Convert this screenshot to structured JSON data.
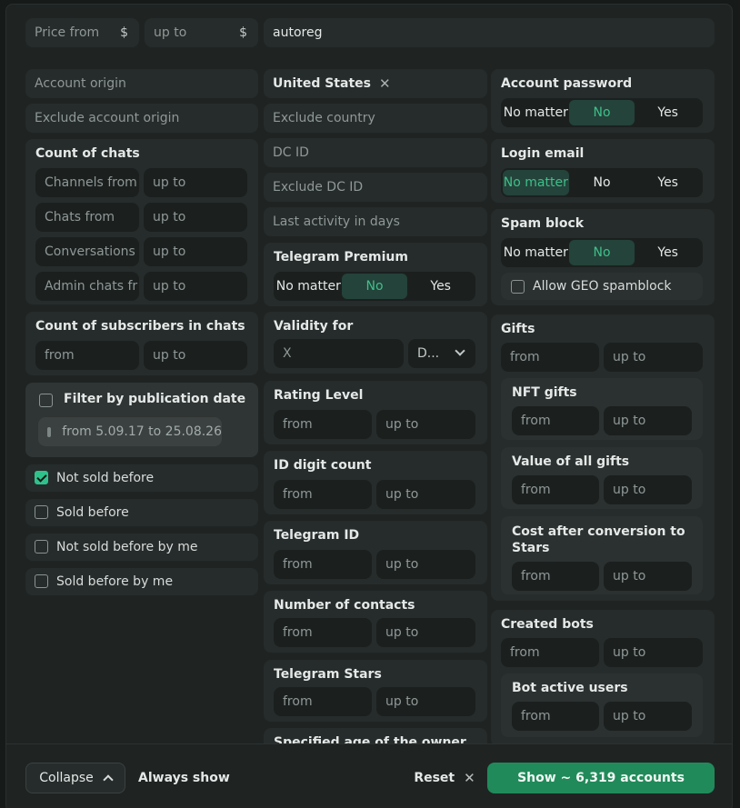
{
  "top": {
    "price_from": "Price from",
    "price_to": "up to",
    "currency": "$",
    "origin_value": "autoreg"
  },
  "col1": {
    "account_origin": "Account origin",
    "exclude_account_origin": "Exclude account origin",
    "count_of_chats": {
      "title": "Count of chats",
      "rows": [
        {
          "from": "Channels from",
          "to": "up to"
        },
        {
          "from": "Chats from",
          "to": "up to"
        },
        {
          "from": "Conversations",
          "to": "up to"
        },
        {
          "from": "Admin chats fr",
          "to": "up to"
        }
      ]
    },
    "subscribers": {
      "title": "Count of subscribers in chats",
      "from": "from",
      "to": "up to"
    },
    "publication": {
      "title": "Filter by publication date",
      "date_range": "from 5.09.17 to 25.08.26",
      "checked": false
    },
    "checks": [
      {
        "label": "Not sold before",
        "checked": true
      },
      {
        "label": "Sold before",
        "checked": false
      },
      {
        "label": "Not sold before by me",
        "checked": false
      },
      {
        "label": "Sold before by me",
        "checked": false
      }
    ]
  },
  "col2": {
    "country_tag": "United States",
    "exclude_country": "Exclude country",
    "dc_id": "DC ID",
    "exclude_dc_id": "Exclude DC ID",
    "last_activity": "Last activity in days",
    "premium": {
      "title": "Telegram Premium",
      "options": [
        "No matter",
        "No",
        "Yes"
      ],
      "active": 1
    },
    "validity": {
      "title": "Validity for",
      "value": "X",
      "unit": "D..."
    },
    "rating": {
      "title": "Rating Level",
      "from": "from",
      "to": "up to"
    },
    "id_digit": {
      "title": "ID digit count",
      "from": "from",
      "to": "up to"
    },
    "telegram_id": {
      "title": "Telegram ID",
      "from": "from",
      "to": "up to"
    },
    "contacts": {
      "title": "Number of contacts",
      "from": "from",
      "to": "up to"
    },
    "stars": {
      "title": "Telegram Stars",
      "from": "from",
      "to": "up to"
    },
    "owner_age": {
      "title": "Specified age of the owner"
    }
  },
  "col3": {
    "password": {
      "title": "Account password",
      "options": [
        "No matter",
        "No",
        "Yes"
      ],
      "active": 1
    },
    "login_email": {
      "title": "Login email",
      "options": [
        "No matter",
        "No",
        "Yes"
      ],
      "active": 0
    },
    "spam": {
      "title": "Spam block",
      "options": [
        "No matter",
        "No",
        "Yes"
      ],
      "active": 1,
      "geo_label": "Allow GEO spamblock"
    },
    "gifts": {
      "title": "Gifts",
      "from": "from",
      "to": "up to",
      "nft": {
        "title": "NFT gifts",
        "from": "from",
        "to": "up to"
      },
      "value": {
        "title": "Value of all gifts",
        "from": "from",
        "to": "up to"
      },
      "cost": {
        "title": "Cost after conversion to Stars",
        "from": "from",
        "to": "up to"
      }
    },
    "bots": {
      "title": "Created bots",
      "from": "from",
      "to": "up to",
      "active": {
        "title": "Bot active users",
        "from": "from",
        "to": "up to"
      }
    }
  },
  "footer": {
    "collapse": "Collapse",
    "always_show": "Always show",
    "reset": "Reset",
    "show": "Show ~ 6,319 accounts"
  },
  "colors": {
    "accent": "#2fc18c",
    "show_button": "#218a5a",
    "panel": "#1f2423"
  },
  "icons": [
    "close-icon",
    "chevron-down-icon",
    "chevron-up-icon",
    "calendar-icon",
    "check-icon"
  ]
}
